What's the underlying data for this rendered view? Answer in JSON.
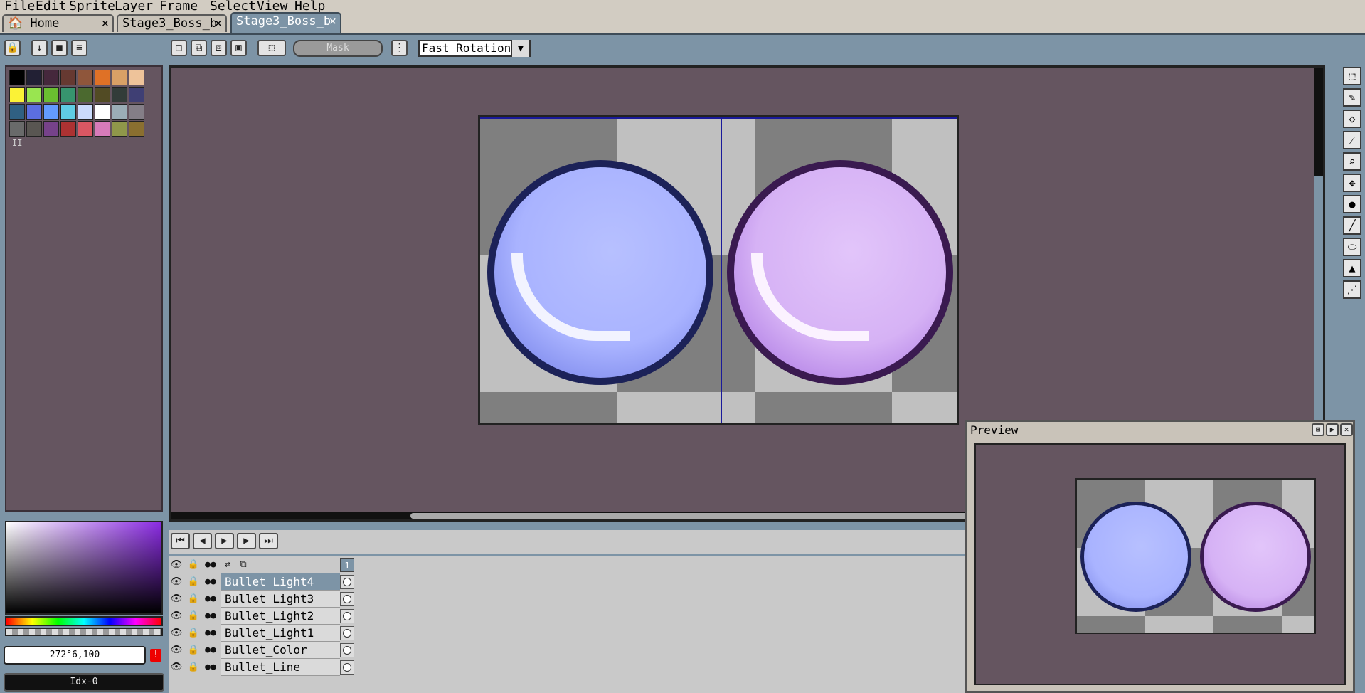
{
  "menu": [
    "File",
    "Edit",
    "Sprite",
    "Layer",
    "Frame",
    "Select",
    "View",
    "Help"
  ],
  "tabs": [
    {
      "label": "🏠 Home",
      "close": "×",
      "active": false
    },
    {
      "label": "Stage3_Boss_b",
      "close": "×",
      "active": false
    },
    {
      "label": "Stage3_Boss_b",
      "close": "×",
      "active": true
    }
  ],
  "toolbar": {
    "mask_label": "Mask",
    "rotation_algorithm": "Fast Rotation",
    "dropdown_arrow": "▼"
  },
  "palette": {
    "colors": [
      "#000000",
      "#222034",
      "#45283c",
      "#663931",
      "#8f563b",
      "#df7126",
      "#d9a066",
      "#eec39a",
      "#fbf236",
      "#99e550",
      "#6abe30",
      "#37946e",
      "#4b692f",
      "#524b24",
      "#323c39",
      "#3f3f74",
      "#306082",
      "#5b6ee1",
      "#639bff",
      "#5fcde4",
      "#cbdbfc",
      "#ffffff",
      "#9badb7",
      "#847e87",
      "#696a6a",
      "#595652",
      "#76428a",
      "#ac3232",
      "#d95763",
      "#d77bba",
      "#8f974a",
      "#8a6f30"
    ],
    "pager": "II"
  },
  "color_info": {
    "hsv_value": "272°6,100",
    "index_value": "Idx-0",
    "warning_icon": "!"
  },
  "timeline": {
    "frame_number": "1",
    "layers": [
      "Bullet_Light4",
      "Bullet_Light3",
      "Bullet_Light2",
      "Bullet_Light1",
      "Bullet_Color",
      "Bullet_Line"
    ]
  },
  "preview": {
    "title": "Preview"
  },
  "colors": {
    "blue_bullet_outline": "#1c2258",
    "blue_bullet_fill": "#a9b3ff",
    "purple_bullet_outline": "#3a1a50",
    "purple_bullet_fill": "#d6b2f5",
    "canvas_bg": "#655560"
  }
}
